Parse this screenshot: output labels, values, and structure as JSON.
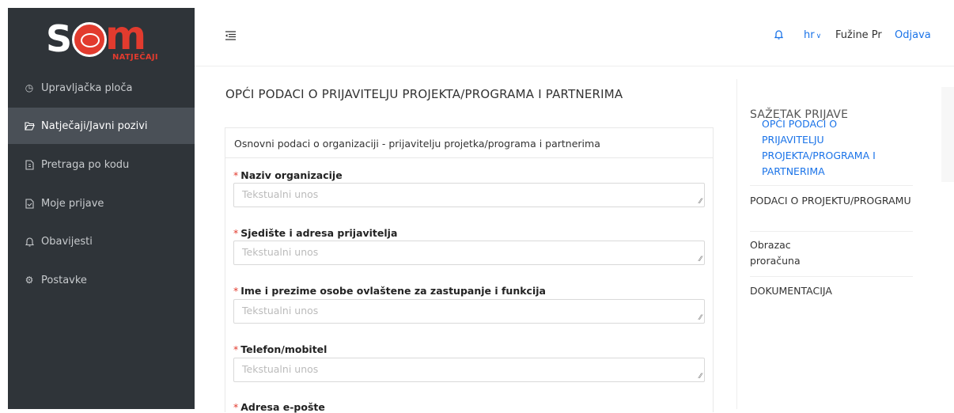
{
  "logo": {
    "letters_left": "S",
    "letters_right": "m",
    "subtitle": "NATJEČAJI"
  },
  "sidebar": {
    "items": [
      {
        "label": "Upravljačka ploča",
        "icon": "dashboard-icon"
      },
      {
        "label": "Natječaji/Javni pozivi",
        "icon": "folder-open-icon",
        "active": true
      },
      {
        "label": "Pretraga po kodu",
        "icon": "file-icon"
      },
      {
        "label": "Moje prijave",
        "icon": "file-text-icon"
      },
      {
        "label": "Obavijesti",
        "icon": "bell-icon"
      },
      {
        "label": "Postavke",
        "icon": "gear-icon"
      }
    ]
  },
  "topbar": {
    "language": "hr",
    "user": "Fužine Pr",
    "logout": "Odjava"
  },
  "main": {
    "title": "OPĆI PODACI O PRIJAVITELJU PROJEKTA/PROGRAMA I PARTNERIMA",
    "card_header": "Osnovni podaci o organizaciji - prijavitelju projetka/programa i partnerima",
    "required_mark": "*",
    "fields": [
      {
        "label": "Naziv organizacije",
        "placeholder": "Tekstualni unos"
      },
      {
        "label": "Sjedište i adresa prijavitelja",
        "placeholder": "Tekstualni unos"
      },
      {
        "label": "Ime i prezime osobe ovlaštene za zastupanje i funkcija",
        "placeholder": "Tekstualni unos"
      },
      {
        "label": "Telefon/mobitel",
        "placeholder": "Tekstualni unos"
      },
      {
        "label": "Adresa e-pošte",
        "placeholder": ""
      }
    ]
  },
  "summary": {
    "title": "SAŽETAK PRIJAVE",
    "items": [
      {
        "label": "OPĆI PODACI O PRIJAVITELJU PROJEKTA/PROGRAMA I PARTNERIMA",
        "active": true
      },
      {
        "label": "PODACI O PROJEKTU/PROGRAMU"
      },
      {
        "label": "Obrazac proračuna"
      },
      {
        "label": "DOKUMENTACIJA"
      }
    ]
  },
  "colors": {
    "sidebar_bg": "#2f3439",
    "sidebar_active": "#4a5057",
    "accent": "#1a73e8",
    "brand": "#e23b2e"
  }
}
